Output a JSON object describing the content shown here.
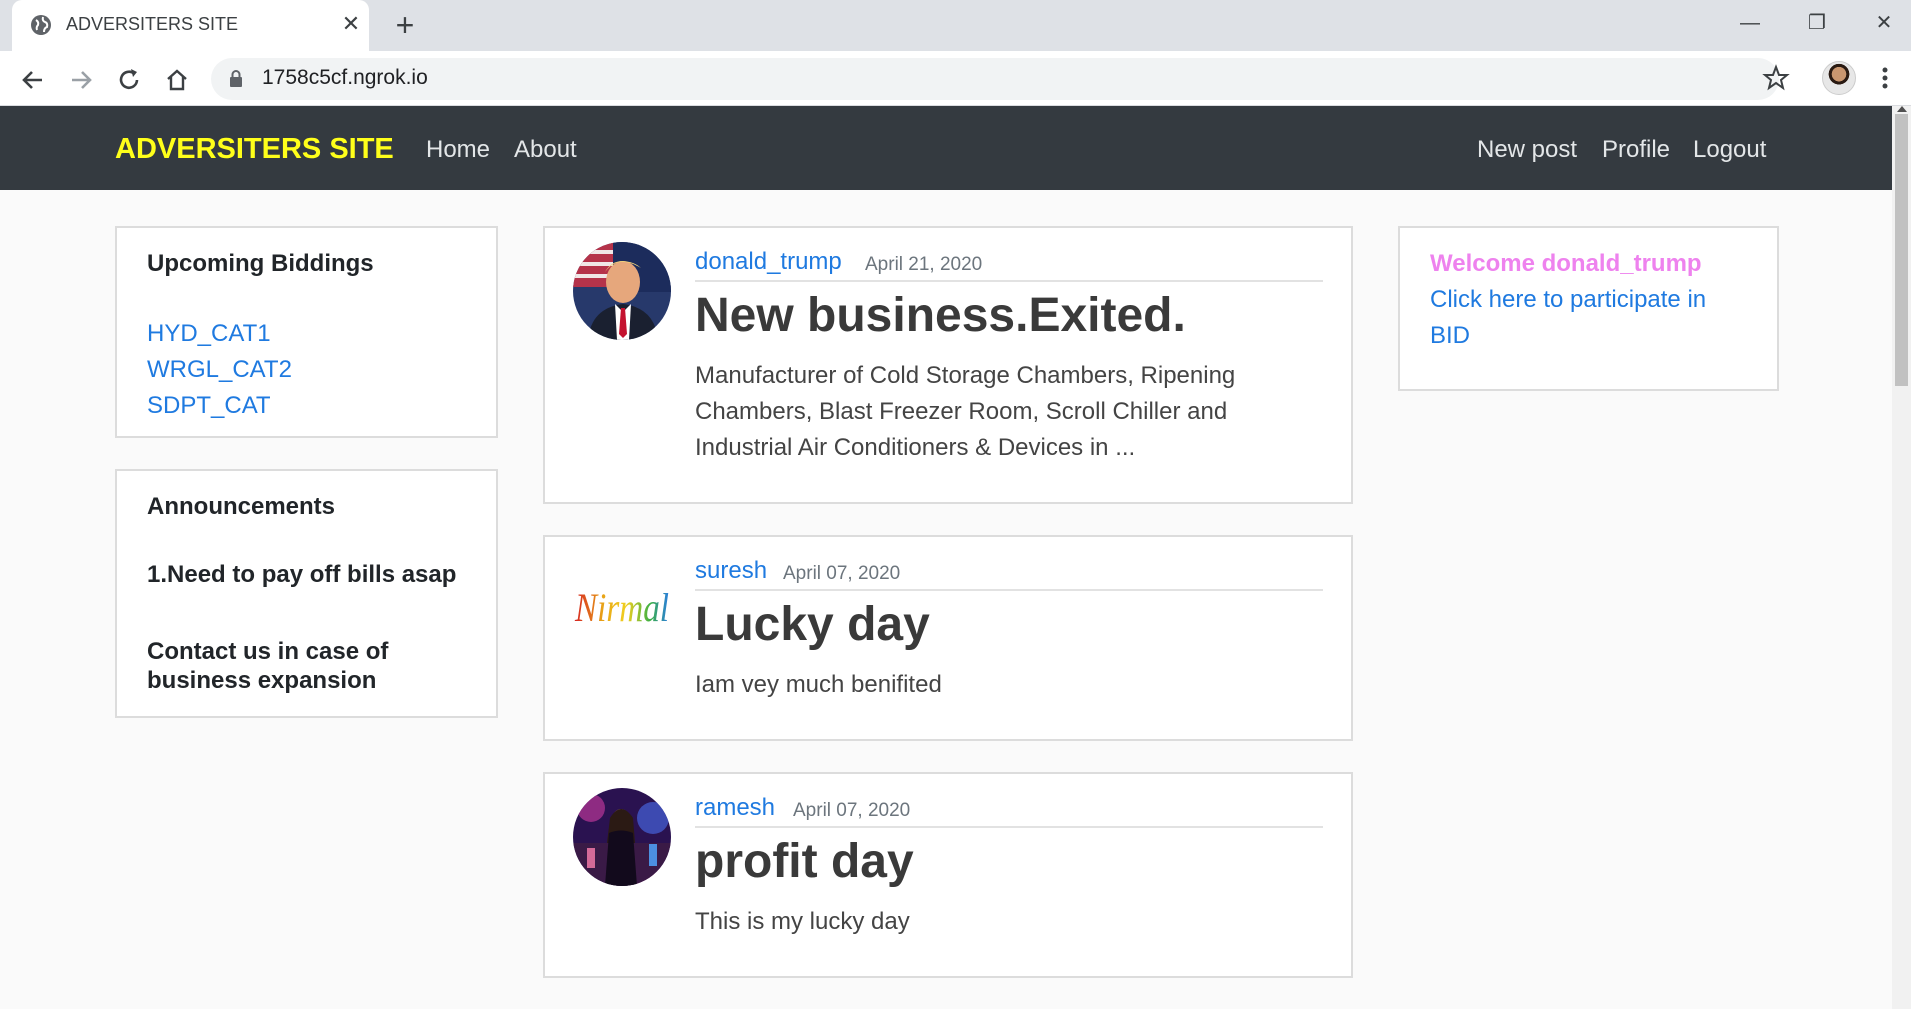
{
  "browser": {
    "tab_title": "ADVERSITERS SITE",
    "url": "1758c5cf.ngrok.io"
  },
  "navbar": {
    "brand": "ADVERSITERS SITE",
    "left_links": [
      "Home",
      "About"
    ],
    "right_links": [
      "New post",
      "Profile",
      "Logout"
    ],
    "brand_color": "#ffff1a",
    "bg_color": "#343a40"
  },
  "sidebar_left": {
    "biddings": {
      "heading": "Upcoming Biddings",
      "items": [
        "HYD_CAT1",
        "WRGL_CAT2",
        "SDPT_CAT"
      ]
    },
    "announcements": {
      "heading": "Announcements",
      "items": [
        "1.Need to pay off bills asap",
        "Contact us in case of business expansion"
      ]
    }
  },
  "posts": [
    {
      "author": "donald_trump",
      "date": "April 21, 2020",
      "title": "New business.Exited.",
      "content": "Manufacturer of Cold Storage Chambers, Ripening Chambers, Blast Freezer Room, Scroll Chiller and Industrial Air Conditioners & Devices in ..."
    },
    {
      "author": "suresh",
      "date": "April 07, 2020",
      "title": "Lucky day",
      "content": "Iam vey much benifited",
      "avatar_text": "Nirmal"
    },
    {
      "author": "ramesh",
      "date": "April 07, 2020",
      "title": "profit day",
      "content": "This is my lucky day"
    }
  ],
  "sidebar_right": {
    "welcome": "Welcome donald_trump",
    "bid_link": "Click here to participate in BID",
    "welcome_color": "#ee82ee"
  },
  "colors": {
    "link": "#1f7ae0",
    "page_bg": "#fafafa"
  }
}
